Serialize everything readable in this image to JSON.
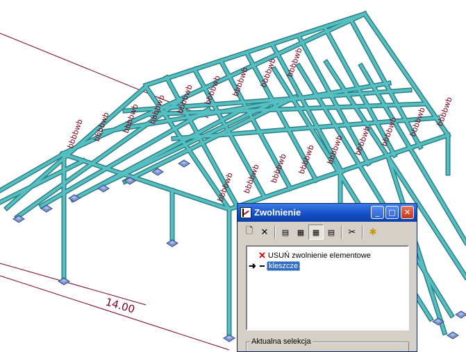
{
  "viewport": {
    "dimension_label": "14.00",
    "release_label": "bbbbwb",
    "member_color": "#56bfc2",
    "support_color": "#6f8fd0"
  },
  "dialog": {
    "title": "Zwolnienie",
    "toolbar": {
      "icons": [
        "new-icon",
        "delete-icon",
        "view-icon-1",
        "view-icon-2",
        "table-view-icon",
        "list-view-icon",
        "cut-icon",
        "new-element-icon"
      ]
    },
    "tree": {
      "items": [
        {
          "label": "USUŃ zwolnienie elementowe",
          "icon": "red-x-icon",
          "selected": false
        },
        {
          "label": "kleszcze",
          "icon": "arrow-right-icon",
          "selected": true
        }
      ]
    },
    "group_label": "Aktualna selekcja"
  }
}
